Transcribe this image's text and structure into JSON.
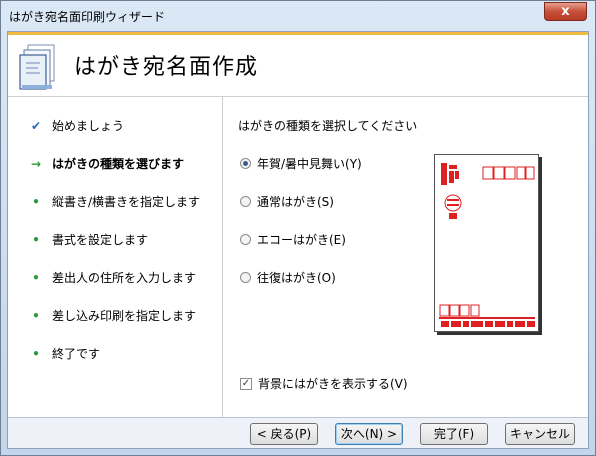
{
  "window": {
    "title": "はがき宛名面印刷ウィザード",
    "close_glyph": "x"
  },
  "header": {
    "title": "はがき宛名面作成"
  },
  "steps": [
    {
      "label": "始めましょう",
      "state": "done",
      "mark": "✔"
    },
    {
      "label": "はがきの種類を選びます",
      "state": "current",
      "mark": "→"
    },
    {
      "label": "縦書き/横書きを指定します",
      "state": "pending",
      "mark": "•"
    },
    {
      "label": "書式を設定します",
      "state": "pending",
      "mark": "•"
    },
    {
      "label": "差出人の住所を入力します",
      "state": "pending",
      "mark": "•"
    },
    {
      "label": "差し込み印刷を指定します",
      "state": "pending",
      "mark": "•"
    },
    {
      "label": "終了です",
      "state": "pending",
      "mark": "•"
    }
  ],
  "panel": {
    "question": "はがきの種類を選択してください",
    "options": [
      {
        "label": "年賀/暑中見舞い(Y)",
        "selected": true
      },
      {
        "label": "通常はがき(S)",
        "selected": false
      },
      {
        "label": "エコーはがき(E)",
        "selected": false
      },
      {
        "label": "往復はがき(O)",
        "selected": false
      }
    ],
    "background_checkbox": {
      "label": "背景にはがきを表示する(V)",
      "checked": true,
      "mark": "✓"
    }
  },
  "buttons": {
    "back": "< 戻る(P)",
    "next": "次へ(N) >",
    "finish": "完了(F)",
    "cancel": "キャンセル"
  },
  "colors": {
    "accent": "#f0b940",
    "check": "#2b66b8",
    "bullet": "#2a9a3a",
    "postcard_red": "#e02020"
  }
}
